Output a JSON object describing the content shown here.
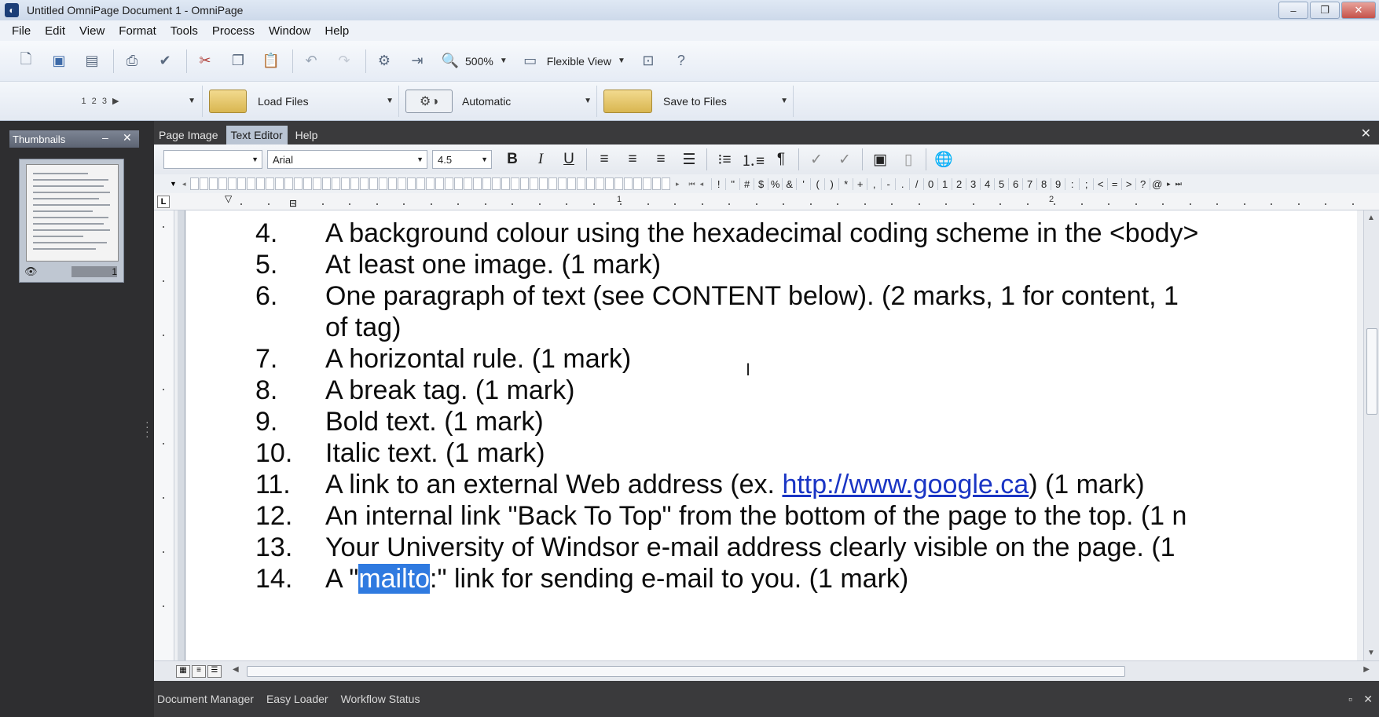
{
  "window": {
    "title": "Untitled OmniPage Document 1 - OmniPage",
    "minimize": "‒",
    "restore": "❐",
    "close": "✕"
  },
  "menu": [
    "File",
    "Edit",
    "View",
    "Format",
    "Tools",
    "Process",
    "Window",
    "Help"
  ],
  "toolbar": {
    "zoom": "500%",
    "view_mode": "Flexible View"
  },
  "workflow": {
    "steps": "1 2 3 ▶",
    "load_label": "Load Files",
    "ocr_label": "Automatic",
    "save_label": "Save to Files"
  },
  "thumbnails": {
    "title": "Thumbnails",
    "page_number": "1"
  },
  "editor_tabs": [
    "Page Image",
    "Text Editor",
    "Help"
  ],
  "active_tab": "Text Editor",
  "format": {
    "style": "",
    "font": "Arial",
    "size": "4.5",
    "bold": "B",
    "italic": "I",
    "underline": "U",
    "pilcrow": "¶"
  },
  "char_glyphs": [
    "!",
    "\"",
    "#",
    "$",
    "%",
    "&",
    "'",
    "(",
    ")",
    "*",
    "+",
    ",",
    "-",
    ".",
    "/",
    "0",
    "1",
    "2",
    "3",
    "4",
    "5",
    "6",
    "7",
    "8",
    "9",
    ":",
    ";",
    "<",
    "=",
    ">",
    "?",
    "@"
  ],
  "ruler": {
    "marks": [
      "1",
      "2"
    ]
  },
  "document": {
    "lines": [
      {
        "num": "4.",
        "text": "A background colour using the hexadecimal coding scheme in the <body>"
      },
      {
        "num": "5.",
        "text": "At least one image. (1 mark)"
      },
      {
        "num": "6.",
        "text": "One paragraph of text (see CONTENT below). (2 marks, 1 for content, 1"
      },
      {
        "num": "",
        "text": "of tag)"
      },
      {
        "num": "7.",
        "text": "A horizontal rule. (1 mark)"
      },
      {
        "num": "8.",
        "text": "A break tag. (1 mark)"
      },
      {
        "num": "9.",
        "text": "Bold text. (1 mark)"
      },
      {
        "num": "10.",
        "text": "Italic text. (1 mark)"
      },
      {
        "num": "11.",
        "text_before": "A link to an external Web address (ex. ",
        "link": "http://www.google.ca",
        "text_after": ") (1 mark)"
      },
      {
        "num": "12.",
        "text": "An internal link \"Back To Top\" from the bottom of the page to the top. (1 n"
      },
      {
        "num": "13.",
        "text": "Your University of Windsor e-mail address clearly visible on the page. (1"
      },
      {
        "num": "14.",
        "text_before": "A \"",
        "selected": "mailto",
        "text_after": ":\" link for sending e-mail to you. (1 mark)"
      }
    ]
  },
  "bottom_tabs": [
    "Document Manager",
    "Easy Loader",
    "Workflow Status"
  ],
  "colors": {
    "link": "#1a35c4",
    "selection": "#2f7ae0",
    "panel_dark": "#2e2e30"
  }
}
